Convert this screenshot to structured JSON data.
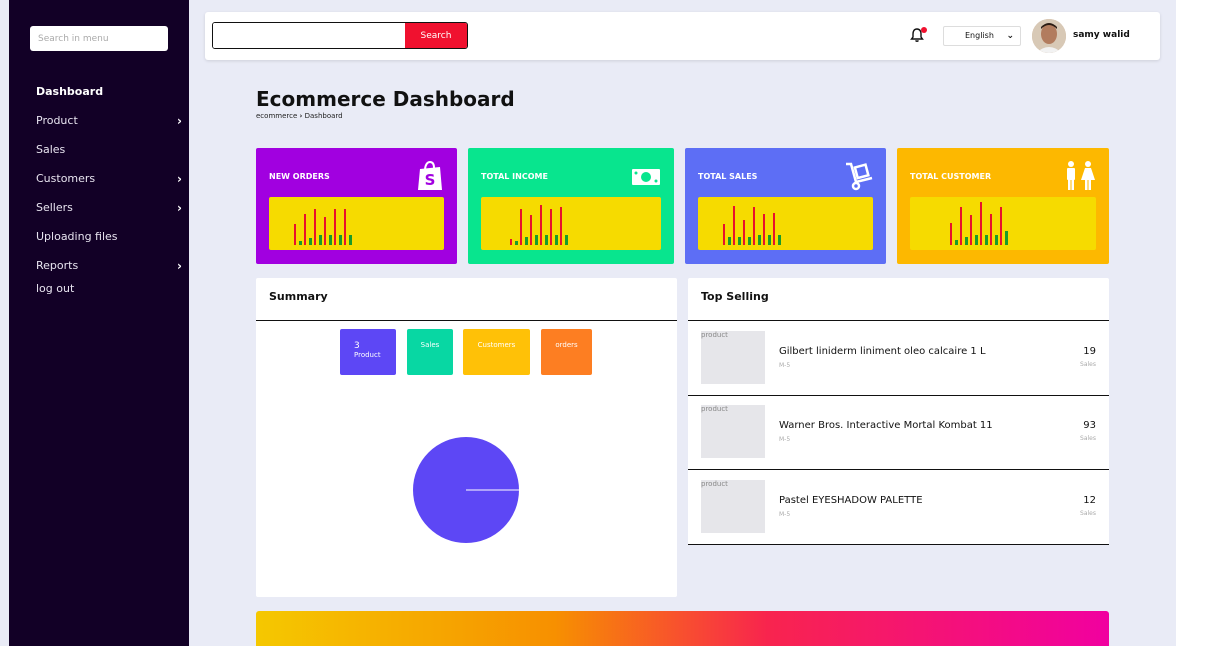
{
  "sidebar": {
    "search_placeholder": "Search in menu",
    "items": [
      {
        "label": "Dashboard",
        "has_children": false,
        "active": true
      },
      {
        "label": "Product",
        "has_children": true
      },
      {
        "label": "Sales",
        "has_children": false
      },
      {
        "label": "Customers",
        "has_children": true
      },
      {
        "label": "Sellers",
        "has_children": true
      },
      {
        "label": "Uploading files",
        "has_children": false
      },
      {
        "label": "Reports",
        "has_children": true
      },
      {
        "label": "log out",
        "has_children": false
      }
    ]
  },
  "topbar": {
    "search_button": "Search",
    "language": "English",
    "username": "samy walid"
  },
  "page": {
    "title": "Ecommerce Dashboard",
    "breadcrumb": [
      "ecommerce",
      "Dashboard"
    ]
  },
  "cards": [
    {
      "label": "NEW ORDERS",
      "color": "#a100e0",
      "icon": "shopify-bag-icon"
    },
    {
      "label": "TOTAL INCOME",
      "color": "#08e58e",
      "icon": "money-icon"
    },
    {
      "label": "TOTAL SALES",
      "color": "#5d6ef5",
      "icon": "hand-truck-icon"
    },
    {
      "label": "TOTAL CUSTOMER",
      "color": "#fdb800",
      "icon": "people-icon"
    }
  ],
  "summary": {
    "title": "Summary",
    "stats": [
      {
        "value": "3",
        "label": "Product",
        "color": "#5d47f5"
      },
      {
        "value": "",
        "label": "Sales",
        "color": "#08d7a3"
      },
      {
        "value": "",
        "label": "Customers",
        "color": "#ffc107"
      },
      {
        "value": "",
        "label": "orders",
        "color": "#fd7e22"
      }
    ],
    "pie_color": "#5d47f5"
  },
  "top_selling": {
    "title": "Top Selling",
    "items": [
      {
        "img_alt": "product",
        "name": "Gilbert liniderm liniment oleo calcaire 1 L",
        "sub": "M-5",
        "count": "19",
        "unit": "Sales"
      },
      {
        "img_alt": "product",
        "name": "Warner Bros. Interactive Mortal Kombat 11",
        "sub": "M-5",
        "count": "93",
        "unit": "Sales"
      },
      {
        "img_alt": "product",
        "name": "Pastel EYESHADOW PALETTE",
        "sub": "M-5",
        "count": "12",
        "unit": "Sales"
      }
    ]
  },
  "colors": {
    "sidebar": "#120026",
    "accent_red": "#f0112f",
    "spark_bg": "#f6db00",
    "spark_red": "#e8112d",
    "spark_green": "#1a9a2a"
  }
}
